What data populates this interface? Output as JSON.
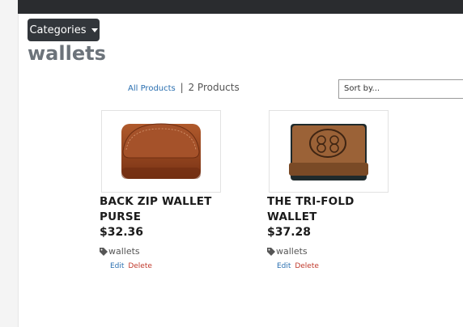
{
  "nav": {
    "categories_label": "Categories"
  },
  "page": {
    "title": "wallets"
  },
  "filters": {
    "all_products_link": "All Products",
    "separator": "|",
    "count_text": "2 Products",
    "sort_placeholder": "Sort by..."
  },
  "products": [
    {
      "title": "BACK ZIP WALLET PURSE",
      "price": "$32.36",
      "tag": "wallets",
      "edit": "Edit",
      "delete": "Delete"
    },
    {
      "title": "THE TRI-FOLD WALLET",
      "price": "$37.28",
      "tag": "wallets",
      "edit": "Edit",
      "delete": "Delete"
    }
  ]
}
